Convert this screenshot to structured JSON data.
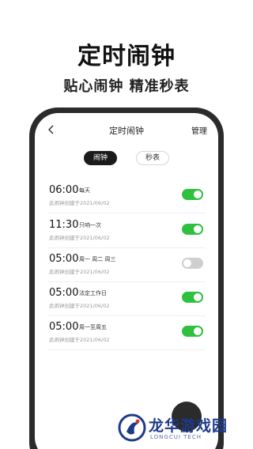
{
  "promo": {
    "title": "定时闹钟",
    "subtitle": "贴心闹钟 精准秒表"
  },
  "nav": {
    "title": "定时闹钟",
    "manage_label": "管理",
    "back_icon": "chevron-left-icon"
  },
  "tabs": [
    {
      "label": "闹钟",
      "active": true
    },
    {
      "label": "秒表",
      "active": false
    }
  ],
  "alarms": [
    {
      "time": "06:00",
      "repeat": "每天",
      "created": "此闹钟创建于2021/06/02",
      "enabled": true
    },
    {
      "time": "11:30",
      "repeat": "只响一次",
      "created": "此闹钟创建于2021/06/02",
      "enabled": true
    },
    {
      "time": "05:00",
      "repeat": "周一 周二 周三",
      "created": "此闹钟创建于2021/06/02",
      "enabled": false
    },
    {
      "time": "05:00",
      "repeat": "法定工作日",
      "created": "此闹钟创建于2021/06/02",
      "enabled": true
    },
    {
      "time": "05:00",
      "repeat": "周一至周五",
      "created": "此闹钟创建于2021/06/02",
      "enabled": true
    }
  ],
  "watermark": {
    "name": "龙华游戏园",
    "sub": "LONGCUI TECH"
  },
  "colors": {
    "toggle_on": "#2fc040",
    "toggle_off": "#cfcfcf",
    "phone_frame": "#2b2b2b",
    "tab_active_bg": "#1b1b1b"
  }
}
